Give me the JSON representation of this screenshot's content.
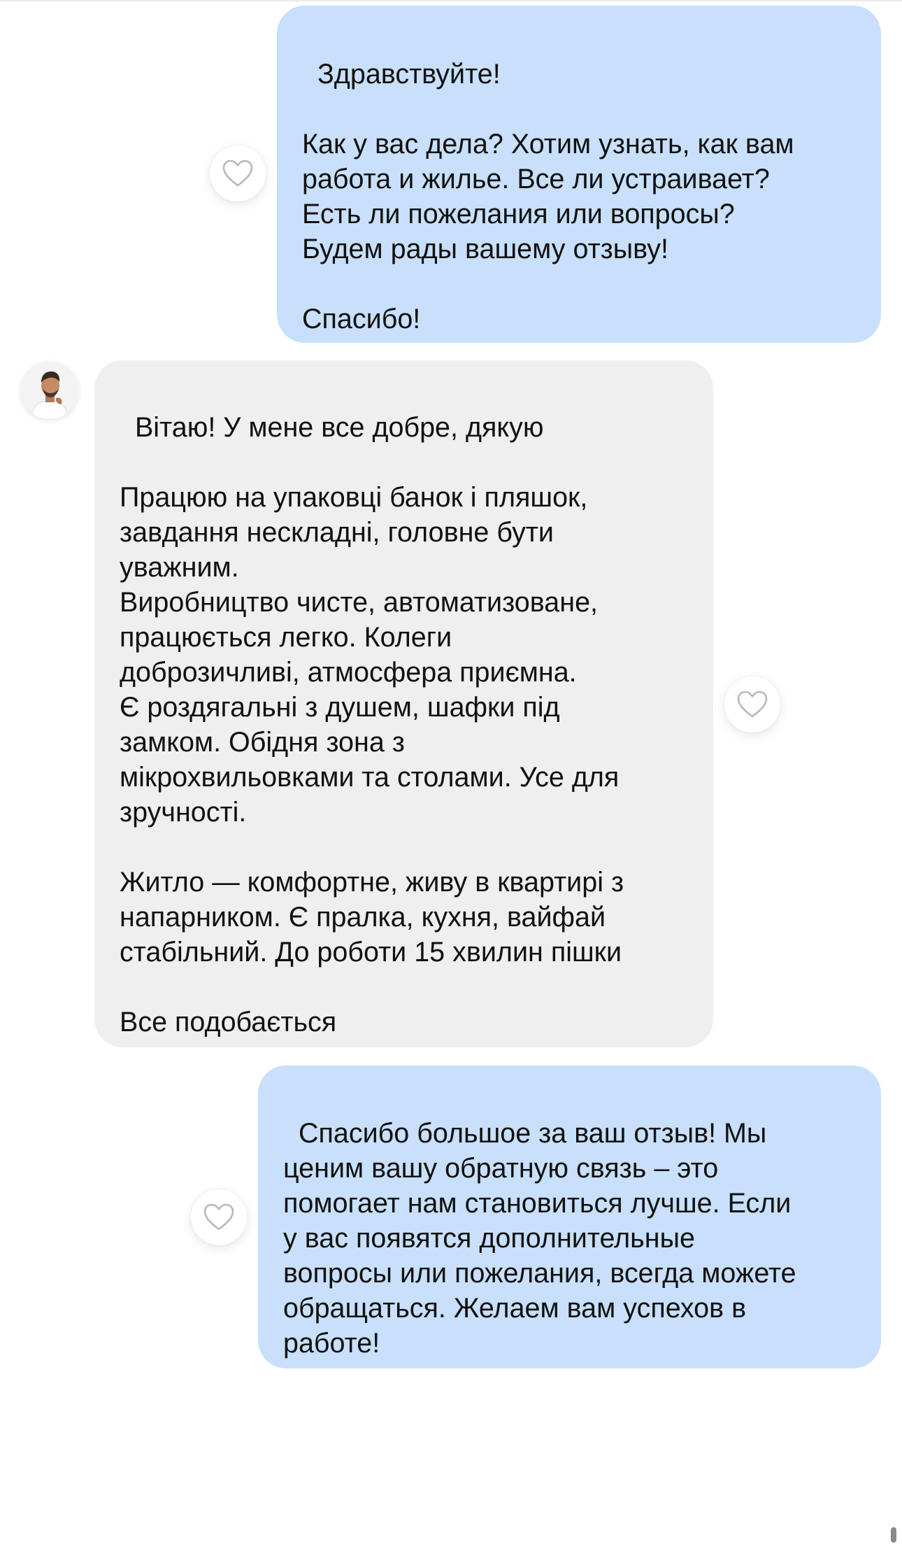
{
  "messages": [
    {
      "direction": "outgoing",
      "text": "Здравствуйте!\n\nКак у вас дела? Хотим узнать, как вам\nработа и жилье. Все ли устраивает?\nЕсть ли пожелания или вопросы?\nБудем рады вашему отзыву!\n\nСпасибо!"
    },
    {
      "direction": "incoming",
      "text": "Вітаю! У мене все добре, дякую\n\nПрацюю на упаковці банок і пляшок,\nзавдання нескладні, головне бути\nуважним.\nВиробництво чисте, автоматизоване,\nпрацюється легко. Колеги\nдоброзичливі, атмосфера приємна.\nЄ роздягальні з душем, шафки під\nзамком. Обідня зона з\nмікрохвильовками та столами. Усе для\nзручності.\n\nЖитло — комфортне, живу в квартирі з\nнапарником. Є пралка, кухня, вайфай\nстабільний. До роботи 15 хвилин пішки\n\nВсе подобається"
    },
    {
      "direction": "outgoing",
      "text": "Спасибо большое за ваш отзыв! Мы\nценим вашу обратную связь – это\nпомогает нам становиться лучше. Если\nу вас появятся дополнительные\nвопросы или пожелания, всегда можете\nобращаться. Желаем вам успехов в\nработе!"
    }
  ],
  "icons": {
    "like": "heart-outline-icon",
    "avatar": "user-avatar"
  },
  "colors": {
    "outgoing_bubble": "#c8e0fb",
    "incoming_bubble": "#efefef",
    "heart_stroke": "#b8b8b8",
    "text": "#111111"
  }
}
